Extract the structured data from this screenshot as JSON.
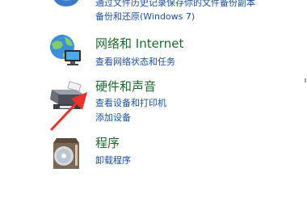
{
  "prev_category": {
    "link1": "通过文件历史记录保存你的文件备份副本",
    "link2": "备份和还原(Windows 7)"
  },
  "categories": [
    {
      "title": "网络和 Internet",
      "links": [
        "查看网络状态和任务"
      ],
      "icon": "network-globe-icon"
    },
    {
      "title": "硬件和声音",
      "links": [
        "查看设备和打印机",
        "添加设备"
      ],
      "icon": "printer-icon"
    },
    {
      "title": "程序",
      "links": [
        "卸载程序"
      ],
      "icon": "programs-disc-icon"
    }
  ],
  "annotation": {
    "arrow_color": "#e8322b"
  }
}
